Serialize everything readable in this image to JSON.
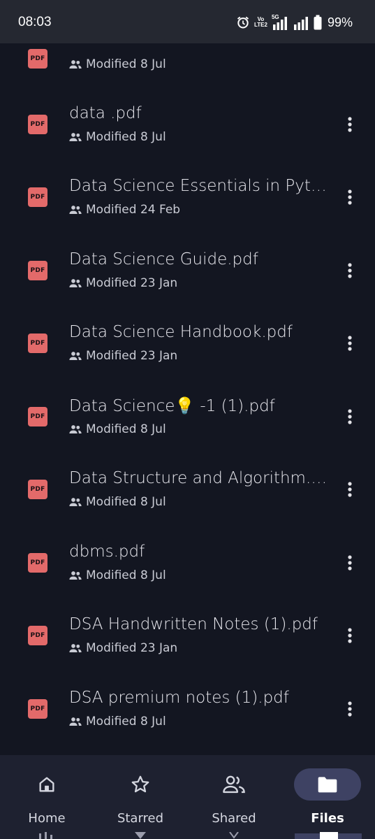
{
  "status_bar": {
    "time": "08:03",
    "network_tag_top": "Vo",
    "network_tag_bottom": "LTE2",
    "network_5g": "5G",
    "battery": "99%"
  },
  "files": [
    {
      "name": "",
      "modified": "Modified 8 Jul",
      "icon_label": "PDF"
    },
    {
      "name": "data .pdf",
      "modified": "Modified 8 Jul",
      "icon_label": "PDF"
    },
    {
      "name": "Data Science Essentials in Pyth...",
      "modified": "Modified 24 Feb",
      "icon_label": "PDF"
    },
    {
      "name": "Data Science Guide.pdf",
      "modified": "Modified 23 Jan",
      "icon_label": "PDF"
    },
    {
      "name": "Data Science Handbook.pdf",
      "modified": "Modified 23 Jan",
      "icon_label": "PDF"
    },
    {
      "name": "Data Science💡 -1 (1).pdf",
      "modified": "Modified 8 Jul",
      "icon_label": "PDF"
    },
    {
      "name": "Data Structure and  Algorithm.pdf",
      "modified": "Modified 8 Jul",
      "icon_label": "PDF"
    },
    {
      "name": "dbms.pdf",
      "modified": "Modified 8 Jul",
      "icon_label": "PDF"
    },
    {
      "name": "DSA Handwritten Notes  (1).pdf",
      "modified": "Modified 23 Jan",
      "icon_label": "PDF"
    },
    {
      "name": "DSA premium notes  (1).pdf",
      "modified": "Modified 8 Jul",
      "icon_label": "PDF"
    }
  ],
  "bottom_nav": {
    "items": [
      {
        "label": "Home",
        "icon": "home-icon",
        "active": false
      },
      {
        "label": "Starred",
        "icon": "star-icon",
        "active": false
      },
      {
        "label": "Shared",
        "icon": "people-icon",
        "active": false
      },
      {
        "label": "Files",
        "icon": "folder-icon",
        "active": true
      }
    ]
  },
  "colors": {
    "background": "#131621",
    "status_bar": "#252831",
    "pdf_icon": "#e36a6a",
    "nav_bar": "#1e2130",
    "nav_active_pill": "#3e4263"
  }
}
